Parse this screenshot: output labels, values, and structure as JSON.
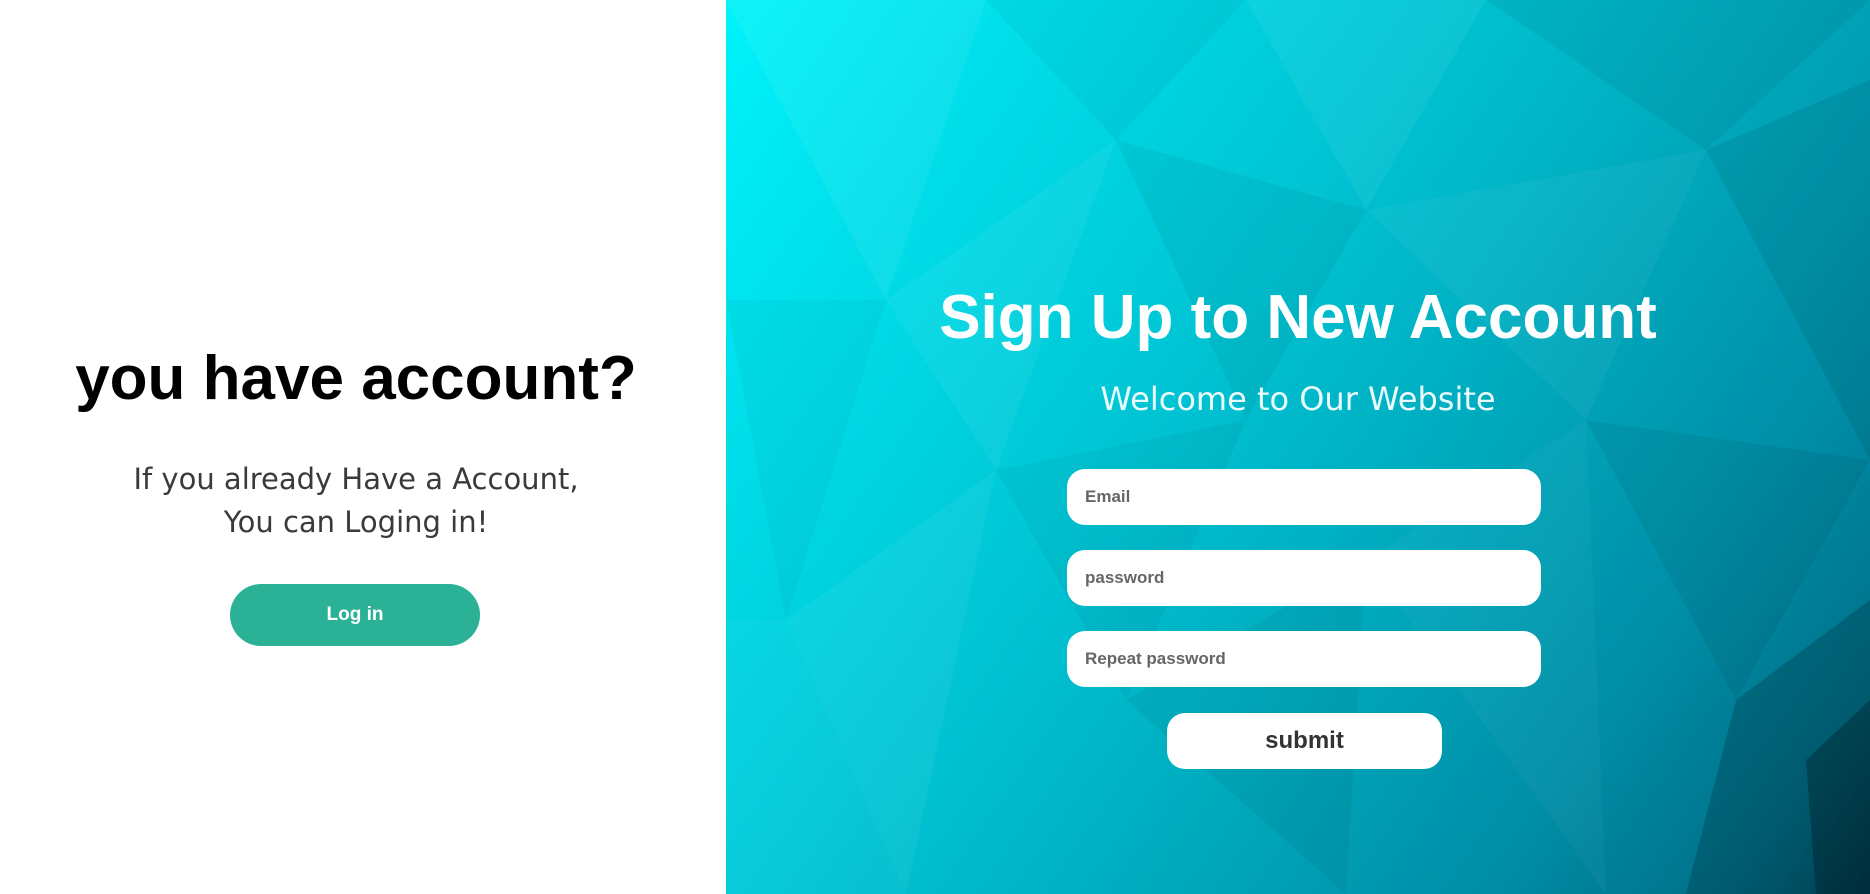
{
  "left": {
    "title": "you have account?",
    "subtitle_line1": "If you already Have a Account,",
    "subtitle_line2": "You can Loging in!",
    "login_label": "Log in"
  },
  "right": {
    "title": "Sign Up to New Account",
    "subtitle": "Welcome to Our Website",
    "email_placeholder": "Email",
    "password_placeholder": "password",
    "repeat_password_placeholder": "Repeat password",
    "submit_label": "submit"
  },
  "colors": {
    "login_button": "#2bb296",
    "panel_gradient_start": "#00f3fb",
    "panel_gradient_end": "#004b62",
    "field_background": "#ffffff"
  }
}
